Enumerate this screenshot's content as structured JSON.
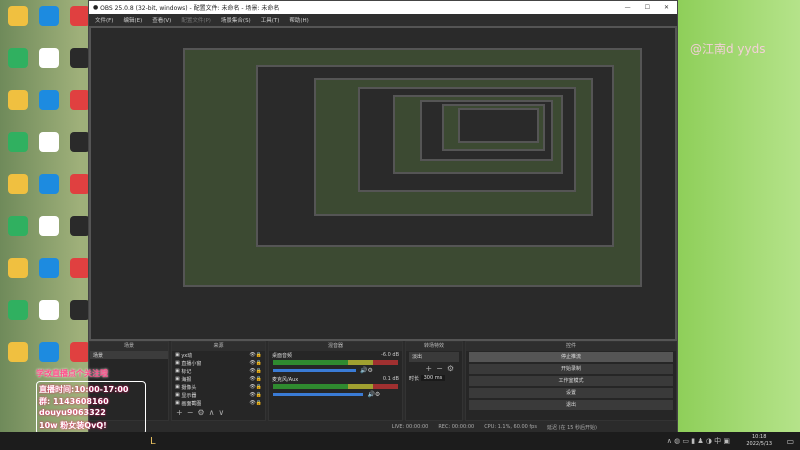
{
  "window": {
    "title": "OBS 25.0.8 (32-bit, windows) - 配置文件: 未命名 - 场景: 未命名",
    "min": "—",
    "max": "☐",
    "close": "✕"
  },
  "menu": [
    "文件(F)",
    "编辑(E)",
    "查看(V)",
    "配置文件(P)",
    "场景集合(S)",
    "工具(T)",
    "帮助(H)"
  ],
  "docks": {
    "scenes": "场景",
    "sources": "来源",
    "mixer": "混音器",
    "transitions": "转场特效",
    "controls": "控件"
  },
  "scenes": [
    "场景"
  ],
  "sources": [
    "yx动",
    "直播小窗",
    "标记",
    "海报",
    "摄像头",
    "显示器",
    "画面截图"
  ],
  "mixer": [
    {
      "name": "桌面音频",
      "db": "-6.0 dB",
      "level": 0.78
    },
    {
      "name": "麦克风/Aux",
      "db": "0.1 dB",
      "level": 0.85
    }
  ],
  "transition": {
    "type": "淡出",
    "duration_label": "时长",
    "duration": "300 ms"
  },
  "controls": [
    "停止推流",
    "开始录制",
    "工作室模式",
    "设置",
    "退出"
  ],
  "status": {
    "live": "LIVE: 00:00:00",
    "rec": "REC: 00:00:00",
    "cpu": "CPU: 1.1%, 60.00 fps",
    "delay": "延迟 (在 15 秒后开始)"
  },
  "overlay": {
    "title": "学改直播点个关注哦",
    "time": "直播时间:10:00-17:00",
    "group": "群: 1143608160",
    "douyin": "douyu9063322",
    "fans": "10w 粉女装QvQ!"
  },
  "watermark": "@江南d yyds",
  "clock": {
    "time": "10:18",
    "date": "2022/5/13"
  },
  "colors": {
    "accent": "#3a7bd5",
    "overlay_pink": "#ff4f8a"
  }
}
